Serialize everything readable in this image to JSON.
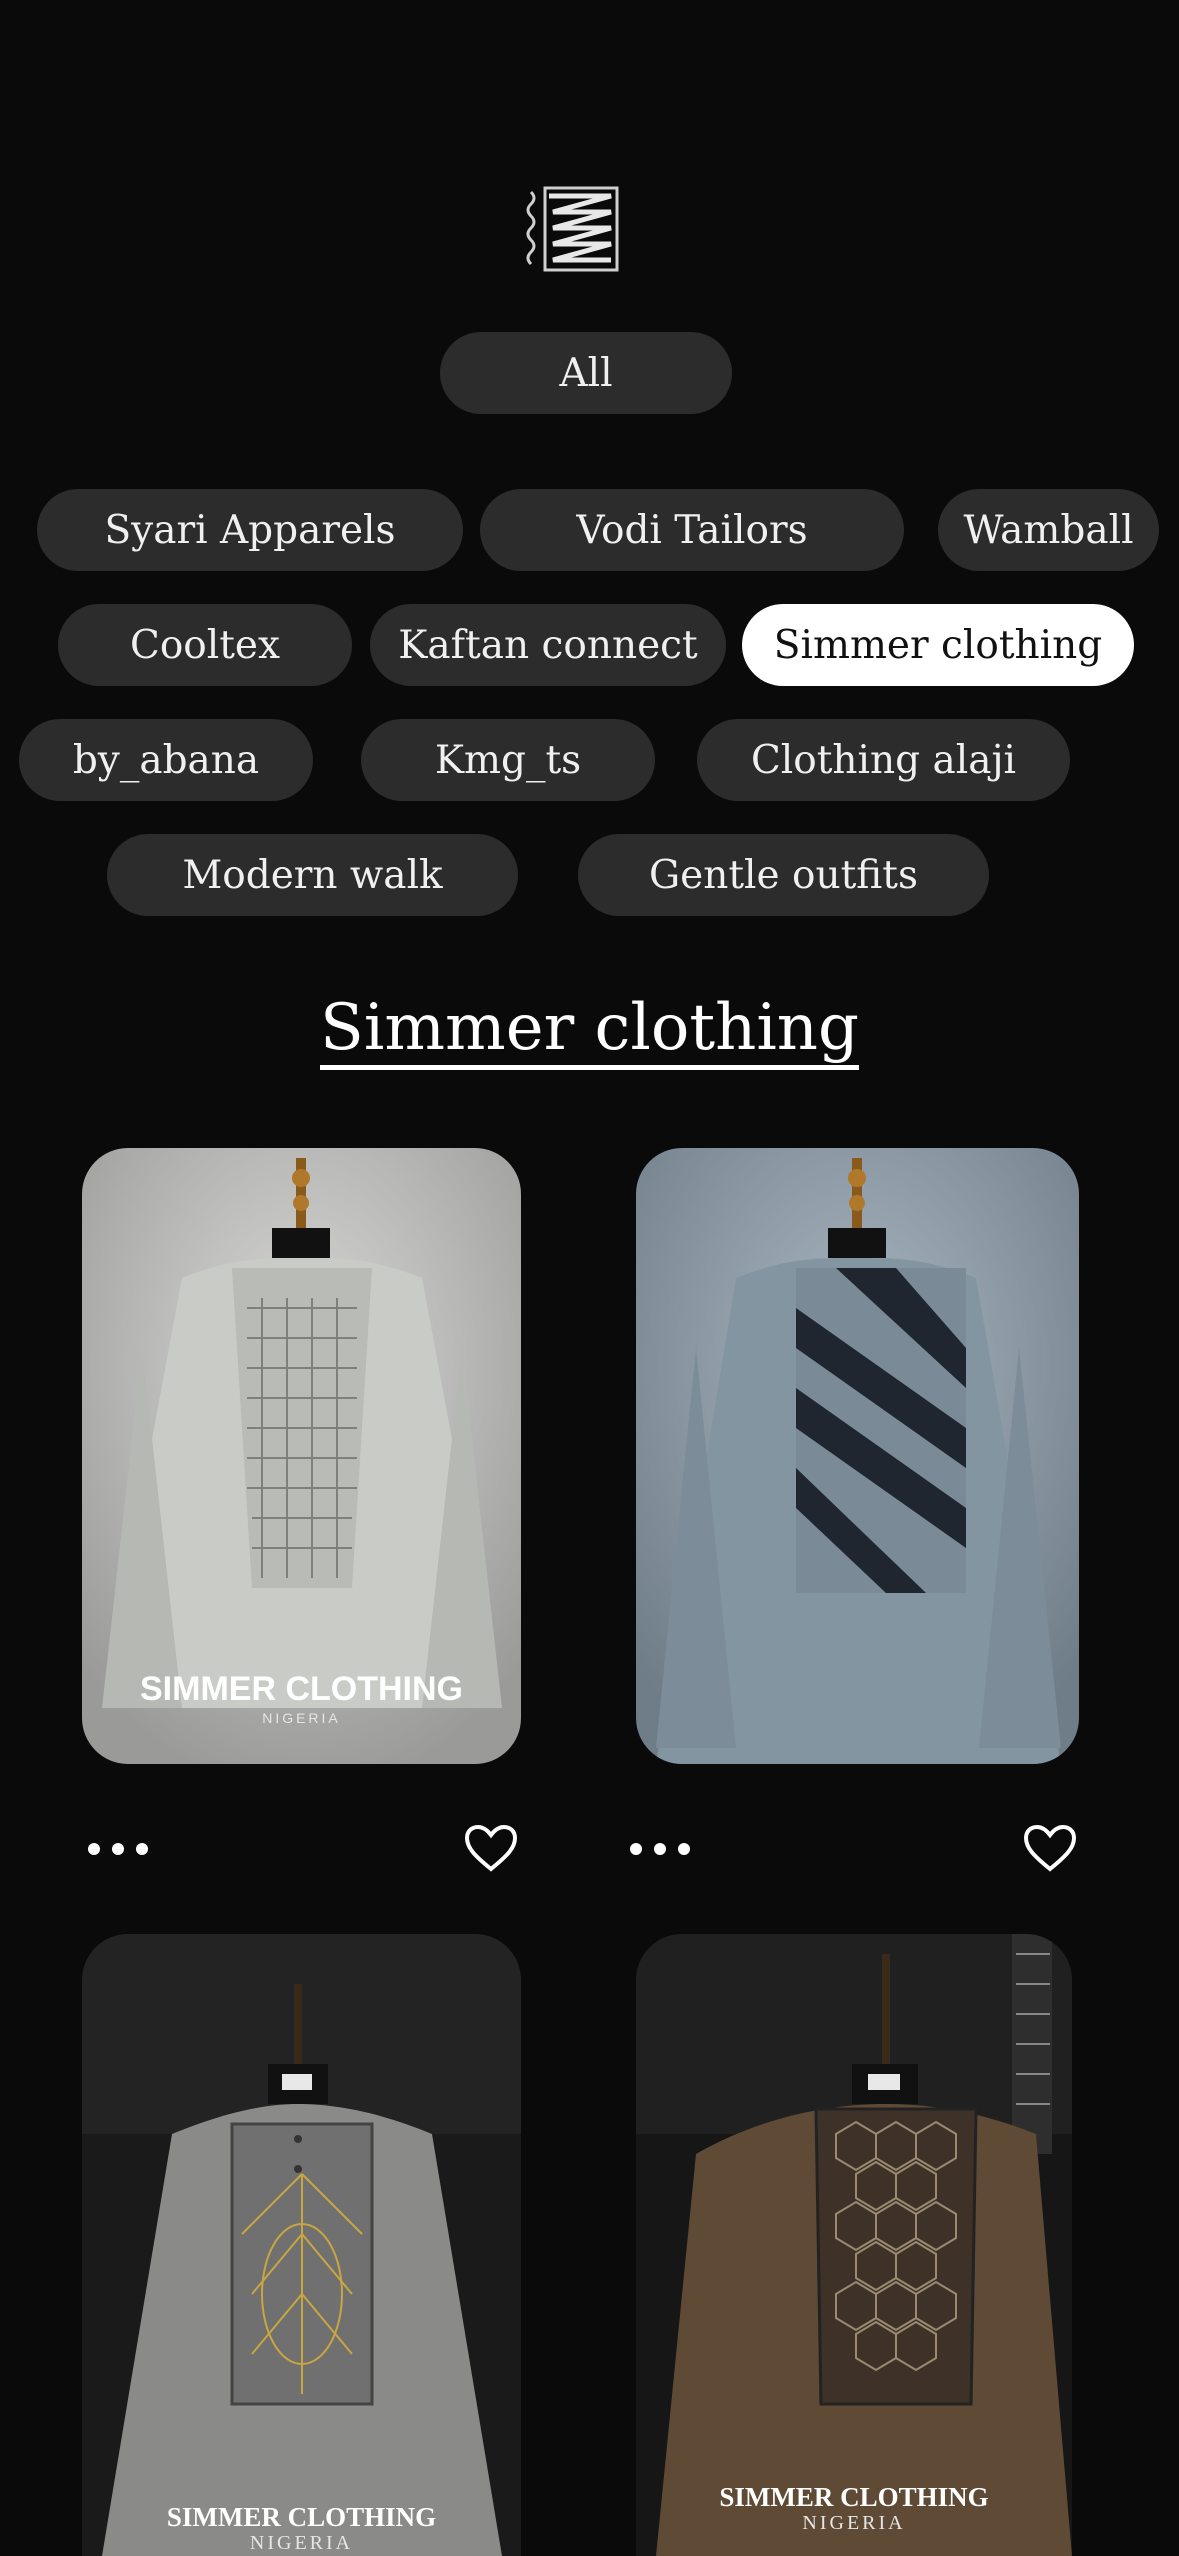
{
  "logo": {
    "icon": "brand-logo-icon"
  },
  "filters": {
    "all": "All",
    "brands": [
      "Syari Apparels",
      "Vodi Tailors",
      "Wamball",
      "Cooltex",
      "Kaftan connect",
      "Simmer clothing",
      "by_abana",
      "Kmg_ts",
      "Clothing alaji",
      "Modern walk",
      "Gentle outfits"
    ],
    "selected": "Simmer clothing"
  },
  "section": {
    "title": "Simmer clothing"
  },
  "products": [
    {
      "caption": "SIMMER CLOTHING",
      "sub": "NIGERIA",
      "color": "#c9ccc6"
    },
    {
      "caption": "",
      "sub": "",
      "color": "#7f8f9c"
    },
    {
      "caption": "SIMMER CLOTHING",
      "sub": "NIGERIA",
      "color": "#8a8a88"
    },
    {
      "caption": "SIMMER CLOTHING",
      "sub": "NIGERIA",
      "color": "#5e4a35"
    }
  ],
  "actions": {
    "more_icon": "more-dots-icon",
    "like_icon": "heart-outline-icon"
  },
  "colors": {
    "background": "#0a0a0a",
    "pill": "#2c2c2c",
    "pill_active": "#ffffff"
  }
}
